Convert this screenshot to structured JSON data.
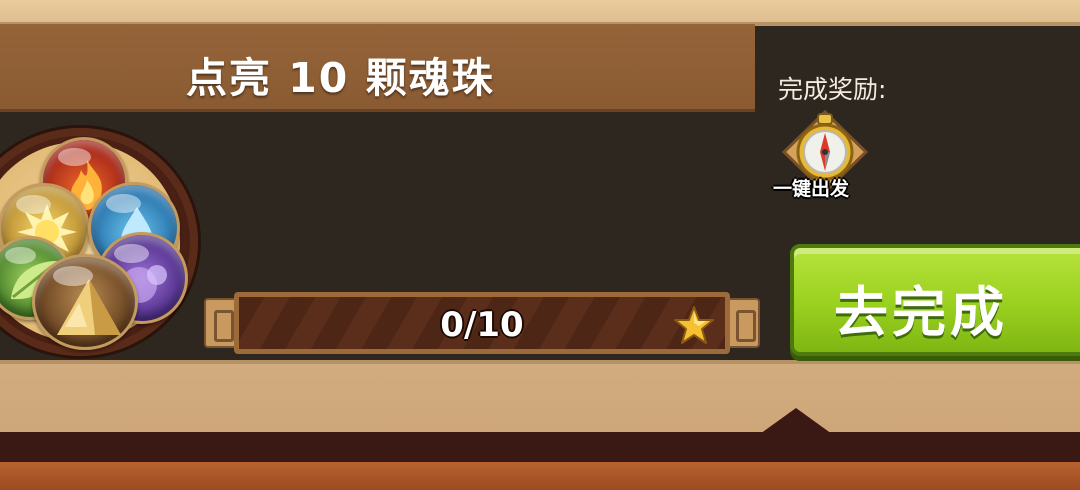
{
  "task": {
    "title": "点亮 10 颗魂珠",
    "orb_types": [
      "fire",
      "sun",
      "water",
      "leaf",
      "shadow",
      "earth"
    ],
    "progress": {
      "current": 0,
      "target": 10,
      "text": "0/10",
      "fraction": 0
    }
  },
  "reward": {
    "label": "完成奖励:",
    "item": {
      "name": "一键出发",
      "icon": "compass-icon"
    }
  },
  "actions": {
    "go_label": "去完成"
  },
  "colors": {
    "panel_bg": "#2e2720",
    "title_banner": "#8e5d34",
    "go_button": "#9ad01f",
    "parchment": "#d7b488"
  }
}
